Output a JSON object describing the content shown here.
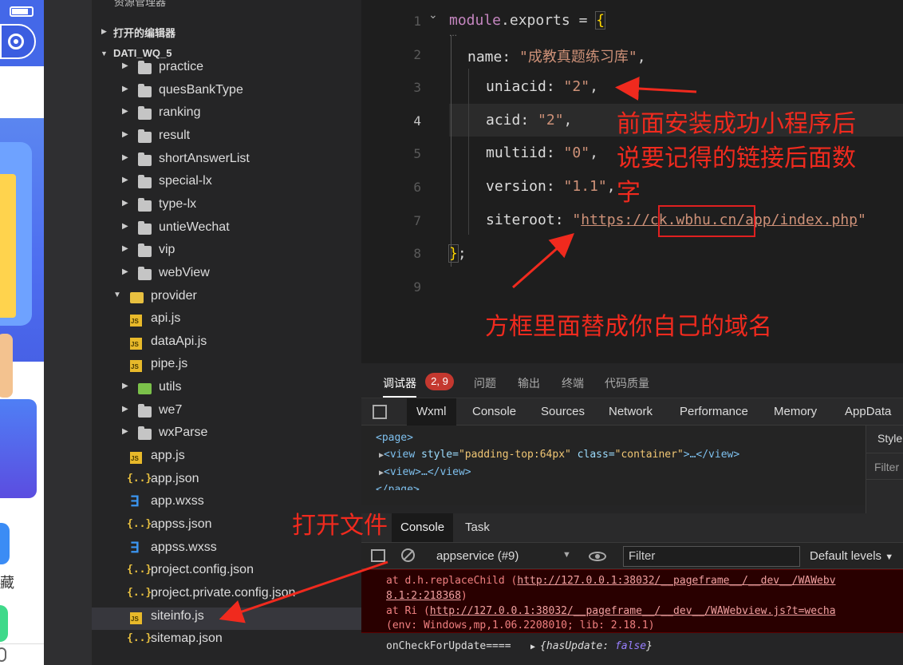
{
  "phone": {
    "label_text": "藏"
  },
  "sidebar": {
    "header_title": "资源管理器",
    "open_editors": "打开的编辑器",
    "project": "DATI_WQ_5",
    "items": [
      {
        "label": "practice",
        "kind": "folder"
      },
      {
        "label": "quesBankType",
        "kind": "folder"
      },
      {
        "label": "ranking",
        "kind": "folder"
      },
      {
        "label": "result",
        "kind": "folder"
      },
      {
        "label": "shortAnswerList",
        "kind": "folder"
      },
      {
        "label": "special-lx",
        "kind": "folder"
      },
      {
        "label": "type-lx",
        "kind": "folder"
      },
      {
        "label": "untieWechat",
        "kind": "folder"
      },
      {
        "label": "vip",
        "kind": "folder"
      },
      {
        "label": "webView",
        "kind": "folder"
      },
      {
        "label": "provider",
        "kind": "folder-open"
      },
      {
        "label": "api.js",
        "kind": "js"
      },
      {
        "label": "dataApi.js",
        "kind": "js"
      },
      {
        "label": "pipe.js",
        "kind": "js"
      },
      {
        "label": "utils",
        "kind": "folder"
      },
      {
        "label": "we7",
        "kind": "folder"
      },
      {
        "label": "wxParse",
        "kind": "folder"
      },
      {
        "label": "app.js",
        "kind": "js"
      },
      {
        "label": "app.json",
        "kind": "json"
      },
      {
        "label": "app.wxss",
        "kind": "wxss"
      },
      {
        "label": "appss.json",
        "kind": "json"
      },
      {
        "label": "appss.wxss",
        "kind": "wxss"
      },
      {
        "label": "project.config.json",
        "kind": "json"
      },
      {
        "label": "project.private.config.json",
        "kind": "json"
      },
      {
        "label": "siteinfo.js",
        "kind": "js"
      },
      {
        "label": "sitemap.json",
        "kind": "json"
      }
    ]
  },
  "editor": {
    "line_numbers": [
      "1",
      "2",
      "3",
      "4",
      "5",
      "6",
      "7",
      "8",
      "9"
    ],
    "l1_kw": "module",
    "l1_rest": ".exports = ",
    "l1_brace": "{",
    "l2_key": "name: ",
    "l2_val": "\"成教真题练习库\"",
    "l3_key": "uniacid: ",
    "l3_val": "\"2\"",
    "l4_key": "acid: ",
    "l4_val": "\"2\"",
    "l5_key": "multiid: ",
    "l5_val": "\"0\"",
    "l6_key": "version: ",
    "l6_val": "\"1.1\"",
    "l7_key": "siteroot: ",
    "l7_q": "\"",
    "l7_url_a": "https://",
    "l7_url_b": "ck.wbhu.cn",
    "l7_url_c": "/app/index.php",
    "l8_brace": "}",
    "comma": ",",
    "semicolon": ";",
    "fold_dots": "..."
  },
  "annotations": {
    "a1_line1": "前面安装成功小程序后",
    "a1_line2": "说要记得的链接后面数",
    "a1_line3": "字",
    "a2": "方框里面替成你自己的域名",
    "a3": "打开文件"
  },
  "panel": {
    "tabs": [
      "调试器",
      "问题",
      "输出",
      "终端",
      "代码质量"
    ],
    "badge": "2, 9",
    "devtools_tabs": [
      "Wxml",
      "Console",
      "Sources",
      "Network",
      "Performance",
      "Memory",
      "AppData"
    ],
    "wxml_lines": {
      "l1": "<page>",
      "l2_tag": "<view",
      "l2_attr1": " style=",
      "l2_val1": "\"padding-top:64px\"",
      "l2_attr2": " class=",
      "l2_val2": "\"container\"",
      "l2_rest": ">…</view>",
      "l3": "<view>…</view>",
      "l4": "</page>"
    },
    "styles_tab": "Style",
    "styles_filter": "Filter",
    "console_tabs": [
      "Console",
      "Task"
    ],
    "context": "appservice (#9)",
    "filter_placeholder": "Filter",
    "levels": "Default levels",
    "errors": {
      "e1_prefix": "    at d.h.replaceChild (",
      "e1_link": "http://127.0.0.1:38032/__pageframe__/__dev__/WAWebv",
      "e1_cont": "8.1:2:218368",
      "e1_close": ")",
      "e2_prefix": "    at Ri (",
      "e2_link": "http://127.0.0.1:38032/__pageframe__/__dev__/WAWebview.js?t=wecha",
      "e3": "(env: Windows,mp,1.06.2208010; lib: 2.18.1)"
    },
    "log_key": "onCheckForUpdate====",
    "log_obj_a": "{hasUpdate: ",
    "log_obj_b": "false",
    "log_obj_c": "}"
  },
  "colors": {
    "annotation": "#f02a1e",
    "accent": "#4468e8",
    "badge": "#c4382f"
  }
}
